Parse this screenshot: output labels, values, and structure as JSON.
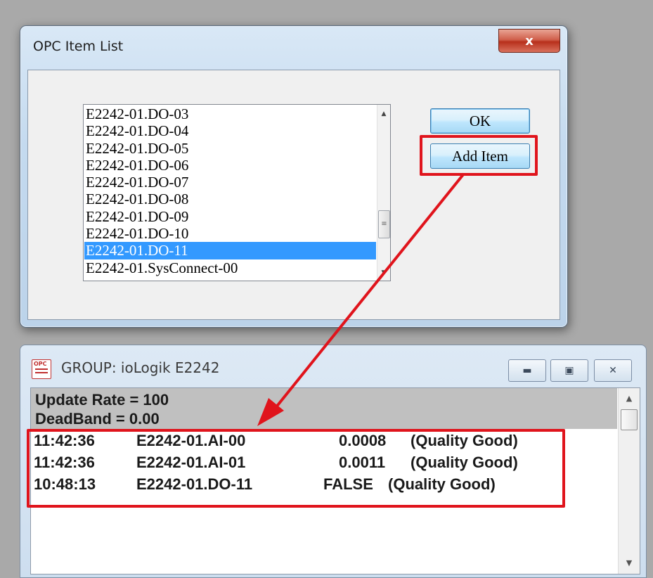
{
  "opc_window": {
    "title": "OPC Item List",
    "close_glyph": "x",
    "items": [
      "E2242-01.DO-03",
      "E2242-01.DO-04",
      "E2242-01.DO-05",
      "E2242-01.DO-06",
      "E2242-01.DO-07",
      "E2242-01.DO-08",
      "E2242-01.DO-09",
      "E2242-01.DO-10",
      "E2242-01.DO-11",
      "E2242-01.SysConnect-00"
    ],
    "selected_item": "E2242-01.DO-11",
    "ok_label": "OK",
    "add_item_label": "Add Item"
  },
  "group_window": {
    "title": "GROUP: ioLogik E2242",
    "update_rate": "Update Rate = 100",
    "deadband": "DeadBand = 0.00",
    "rows": [
      {
        "time": "11:42:36",
        "item": "E2242-01.AI-00",
        "value": "0.0008",
        "quality": "(Quality Good)"
      },
      {
        "time": "11:42:36",
        "item": "E2242-01.AI-01",
        "value": "0.0011",
        "quality": "(Quality Good)"
      },
      {
        "time": "10:48:13",
        "item": "E2242-01.DO-11",
        "value": "FALSE",
        "quality": "(Quality Good)"
      }
    ]
  },
  "colors": {
    "highlight_box": "#e0141c",
    "selection": "#3399ff"
  }
}
